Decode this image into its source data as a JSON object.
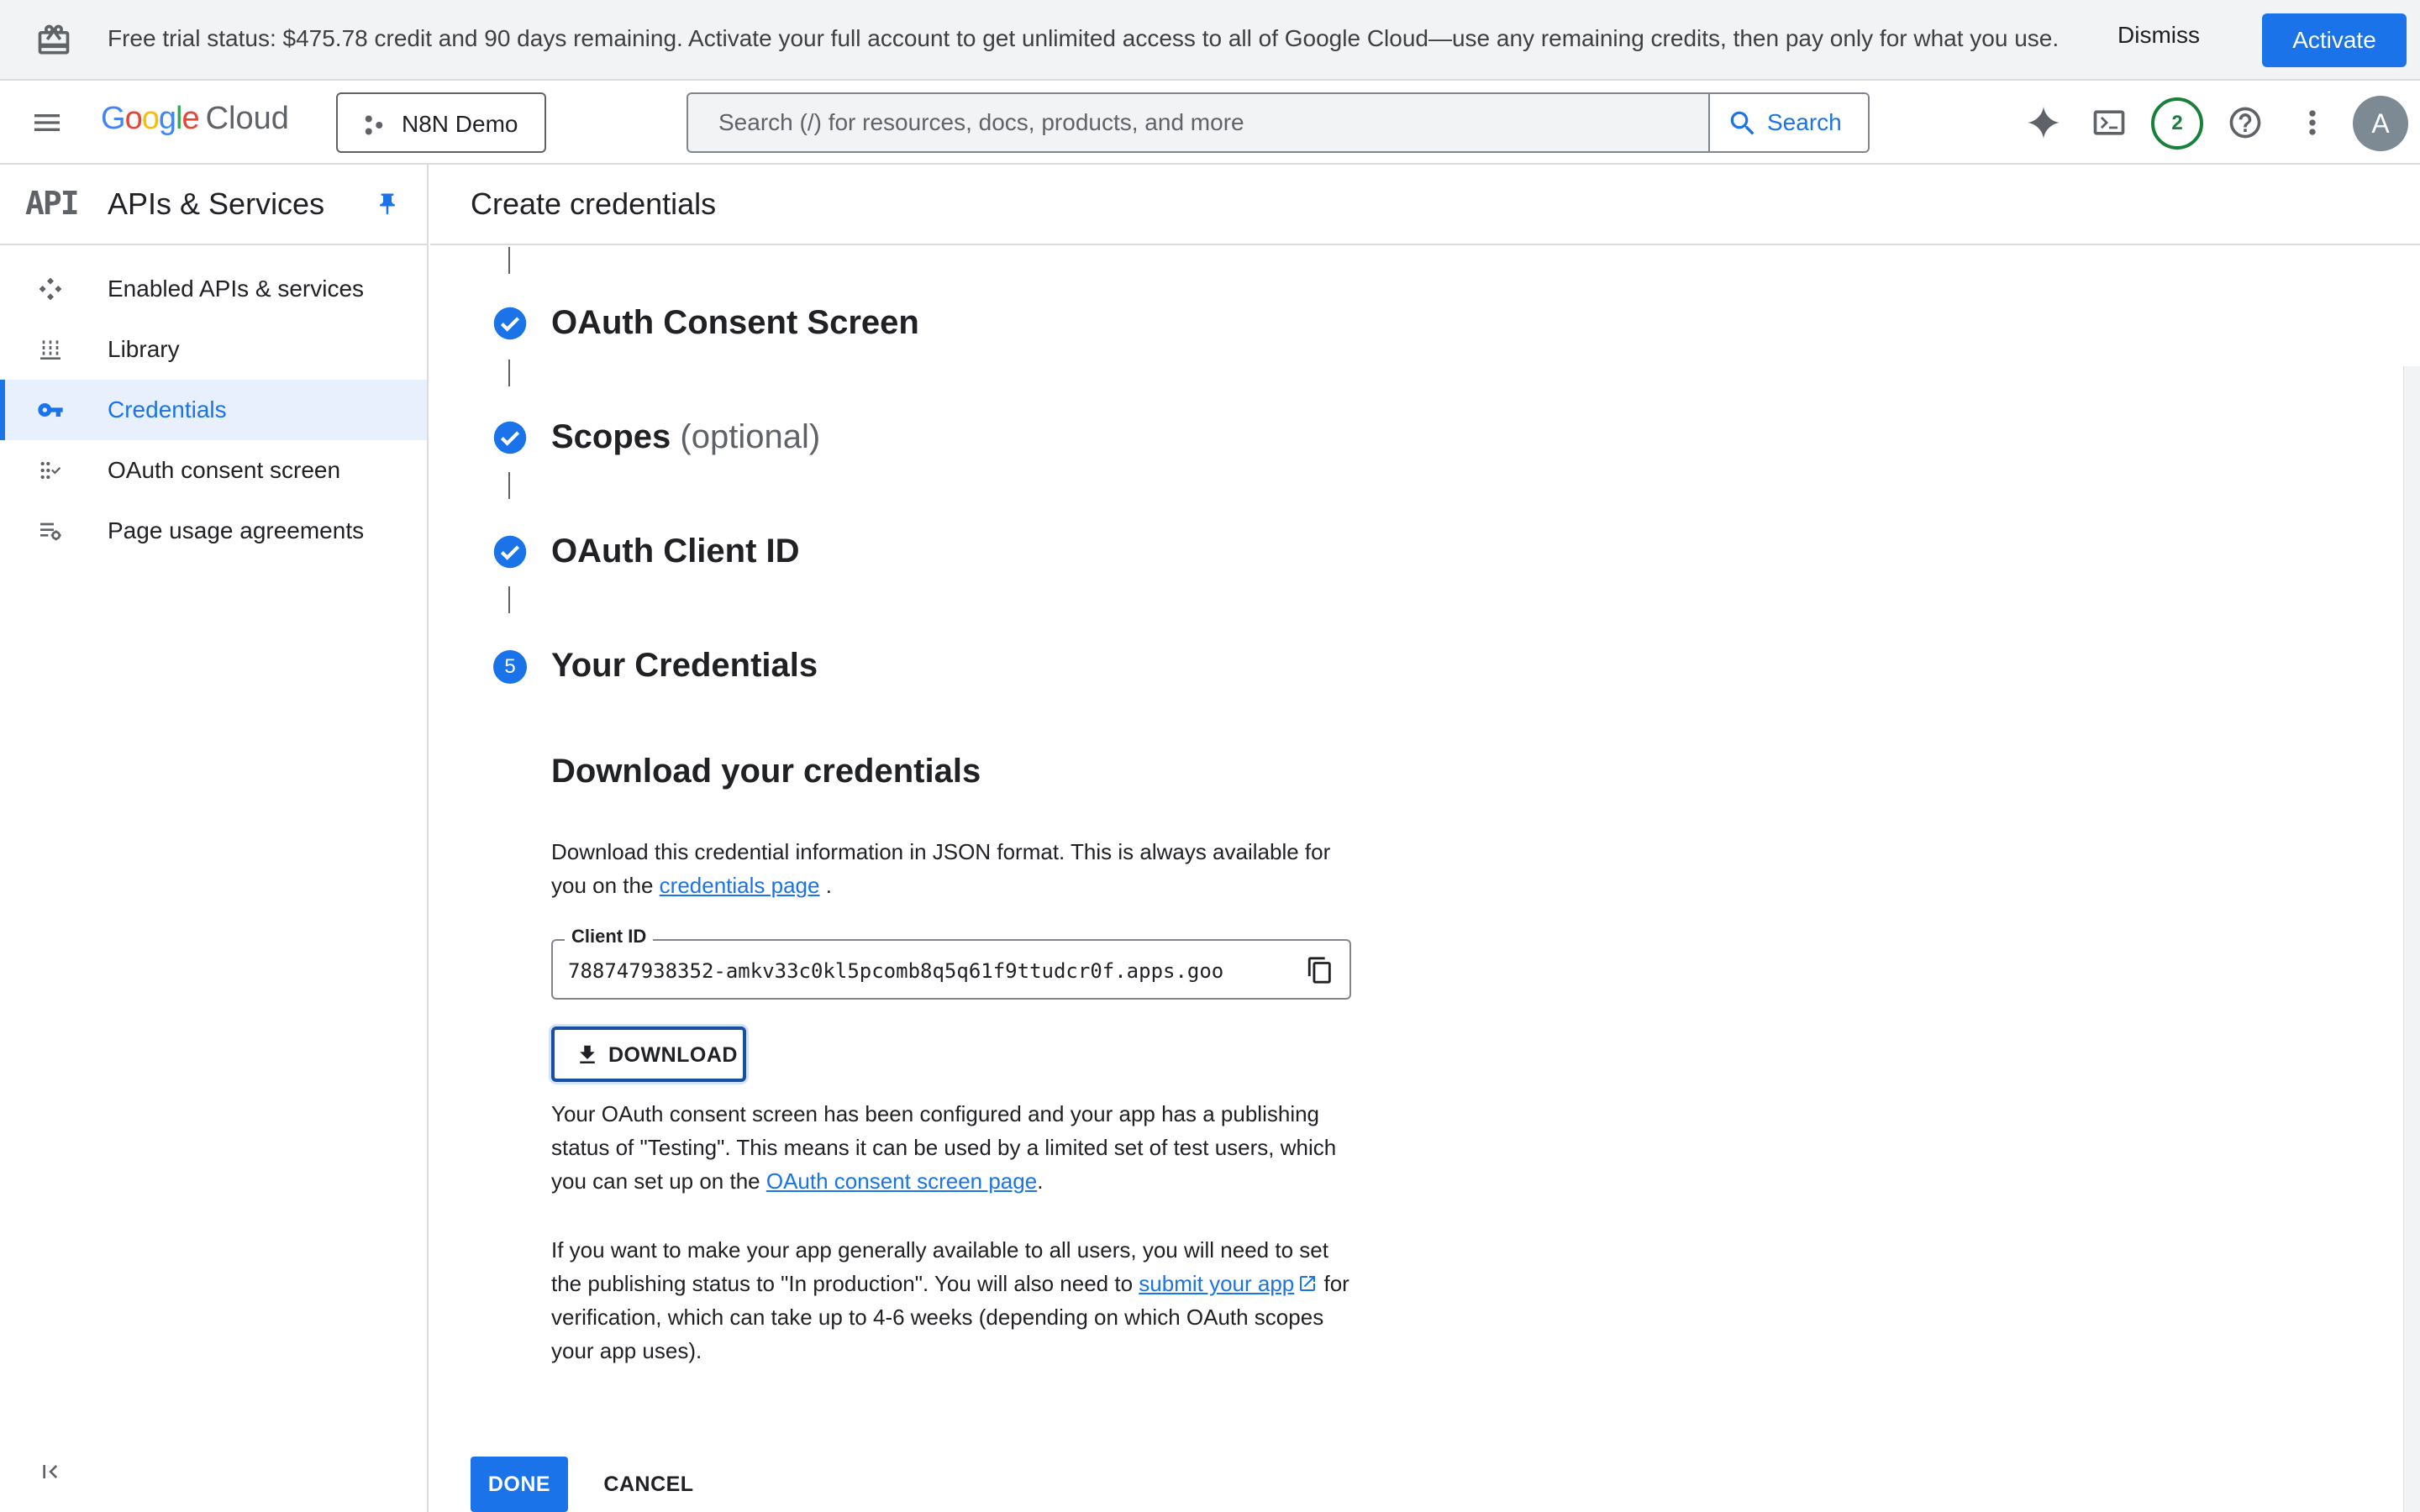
{
  "banner": {
    "text": "Free trial status: $475.78 credit and 90 days remaining. Activate your full account to get unlimited access to all of Google Cloud—use any remaining credits, then pay only for what you use.",
    "dismiss_label": "Dismiss",
    "activate_label": "Activate"
  },
  "header": {
    "logo_google": "Google",
    "logo_cloud": "Cloud",
    "project_name": "N8N Demo",
    "search_placeholder": "Search (/) for resources, docs, products, and more",
    "search_button_label": "Search",
    "notification_count": "2",
    "avatar_initial": "A",
    "icons": [
      "menu-icon",
      "gemini-sparkle-icon",
      "cloud-shell-icon",
      "help-icon",
      "more-vert-icon"
    ]
  },
  "sidebar": {
    "api_logo": "API",
    "title": "APIs & Services",
    "items": [
      {
        "label": "Enabled APIs & services",
        "icon": "enabled-apis-icon"
      },
      {
        "label": "Library",
        "icon": "library-icon"
      },
      {
        "label": "Credentials",
        "icon": "key-icon",
        "active": true
      },
      {
        "label": "OAuth consent screen",
        "icon": "oauth-consent-icon"
      },
      {
        "label": "Page usage agreements",
        "icon": "page-usage-icon"
      }
    ]
  },
  "main": {
    "page_title": "Create credentials",
    "steps": [
      {
        "title": "OAuth Consent Screen",
        "status": "done"
      },
      {
        "title": "Scopes",
        "optional": "(optional)",
        "status": "done"
      },
      {
        "title": "OAuth Client ID",
        "status": "done"
      },
      {
        "number": "5",
        "title": "Your Credentials",
        "status": "current"
      }
    ],
    "download_section": {
      "title": "Download your credentials",
      "intro_text": "Download this credential information in JSON format. This is always available for you on the",
      "intro_link": "credentials page",
      "intro_end": ".",
      "client_id_label": "Client ID",
      "client_id_value": "788747938352-amkv33c0kl5pcomb8q5q61f9ttudcr0f.apps.goo",
      "download_label": "DOWNLOAD",
      "testing_text": "Your OAuth consent screen has been configured and your app has a publishing status of \"Testing\". This means it can be used by a limited set of test users, which you can set up on the",
      "testing_link": "OAuth consent screen page",
      "testing_end": ".",
      "production_text": "If you want to make your app generally available to all users, you will need to set the publishing status to \"In production\". You will also need to",
      "production_link": "submit your app",
      "production_end": "for verification, which can take up to 4-6 weeks (depending on which OAuth scopes your app uses)."
    },
    "done_label": "DONE",
    "cancel_label": "CANCEL"
  },
  "colors": {
    "accent": "#1a73e8",
    "active_nav_bg": "#e8f0fe",
    "notification_ring": "#188038"
  }
}
